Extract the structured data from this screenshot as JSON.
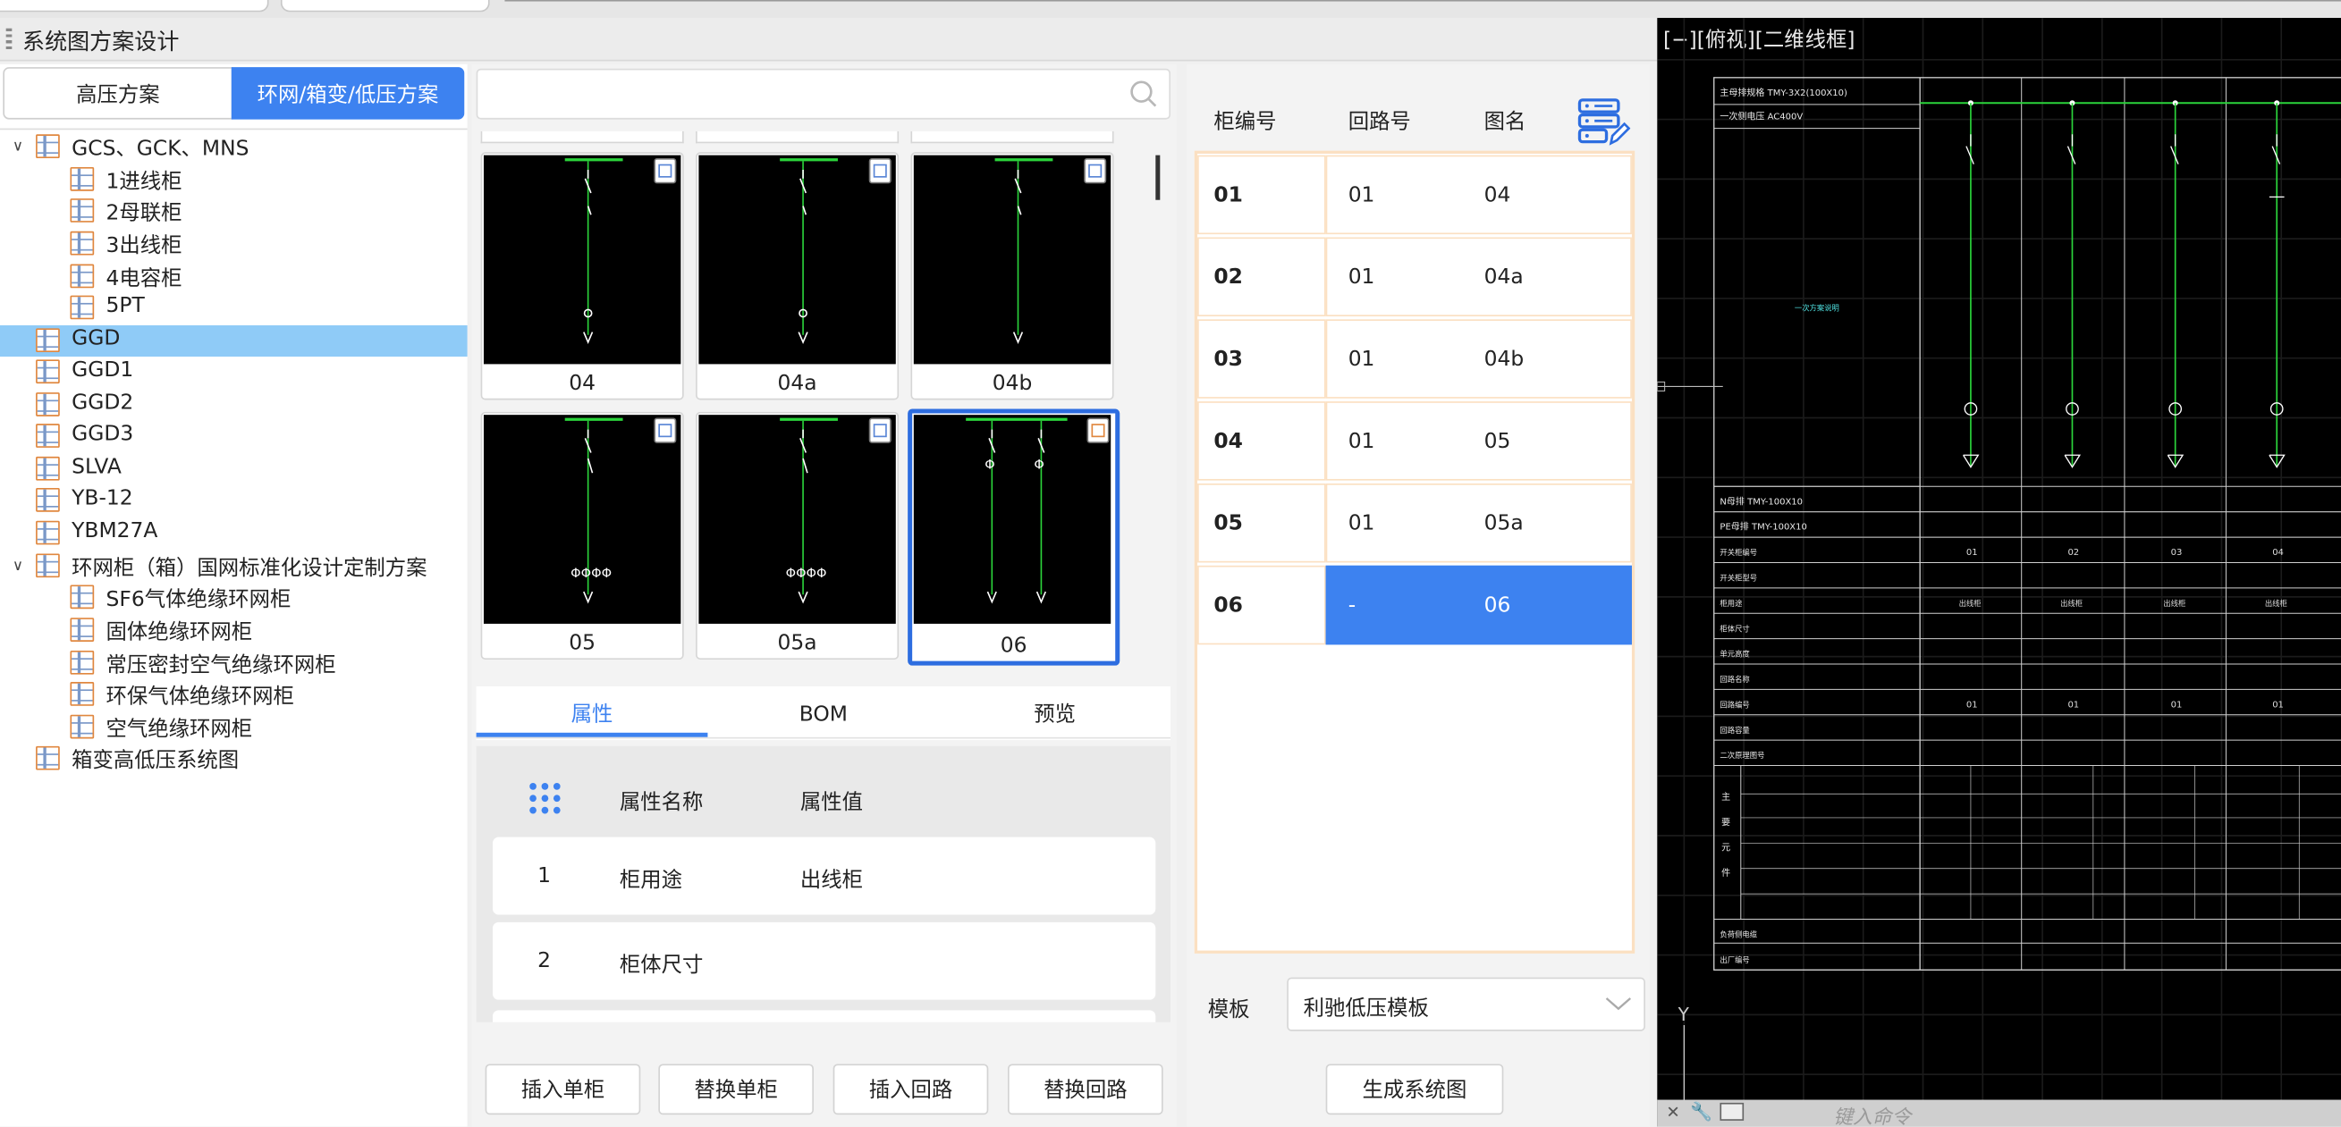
{
  "window": {
    "title": "系统图方案设计"
  },
  "left_tabs": {
    "high": "高压方案",
    "ring": "环网/箱变/低压方案"
  },
  "tree": [
    {
      "label": "GCS、GCK、MNS",
      "expanded": true
    },
    {
      "label": "1进线柜"
    },
    {
      "label": "2母联柜"
    },
    {
      "label": "3出线柜"
    },
    {
      "label": "4电容柜"
    },
    {
      "label": "5PT"
    },
    {
      "label": "GGD",
      "selected": true
    },
    {
      "label": "GGD1"
    },
    {
      "label": "GGD2"
    },
    {
      "label": "GGD3"
    },
    {
      "label": "SLVA"
    },
    {
      "label": "YB-12"
    },
    {
      "label": "YBM27A"
    },
    {
      "label": "环网柜（箱）国网标准化设计定制方案",
      "expanded": true
    },
    {
      "label": "SF6气体绝缘环网柜"
    },
    {
      "label": "固体绝缘环网柜"
    },
    {
      "label": "常压密封空气绝缘环网柜"
    },
    {
      "label": "环保气体绝缘环网柜"
    },
    {
      "label": "空气绝缘环网柜"
    },
    {
      "label": "箱变高低压系统图"
    }
  ],
  "search": {
    "placeholder": ""
  },
  "thumbnails": [
    {
      "label": "04"
    },
    {
      "label": "04a"
    },
    {
      "label": "04b"
    },
    {
      "label": "05"
    },
    {
      "label": "05a"
    },
    {
      "label": "06",
      "selected": true
    }
  ],
  "prop_tabs": {
    "attr": "属性",
    "bom": "BOM",
    "preview": "预览"
  },
  "prop_table": {
    "header": {
      "name": "属性名称",
      "value": "属性值"
    },
    "rows": [
      {
        "index": "1",
        "name": "柜用途",
        "value": "出线柜"
      },
      {
        "index": "2",
        "name": "柜体尺寸",
        "value": ""
      }
    ]
  },
  "buttons": {
    "insert_cabinet": "插入单柜",
    "replace_cabinet": "替换单柜",
    "insert_circuit": "插入回路",
    "replace_circuit": "替换回路",
    "generate": "生成系统图"
  },
  "grid": {
    "headers": {
      "cabinet": "柜编号",
      "circuit": "回路号",
      "drawing": "图名"
    },
    "rows": [
      {
        "cabinet": "01",
        "circuit": "01",
        "drawing": "04"
      },
      {
        "cabinet": "02",
        "circuit": "01",
        "drawing": "04a"
      },
      {
        "cabinet": "03",
        "circuit": "01",
        "drawing": "04b"
      },
      {
        "cabinet": "04",
        "circuit": "01",
        "drawing": "05"
      },
      {
        "cabinet": "05",
        "circuit": "01",
        "drawing": "05a"
      },
      {
        "cabinet": "06",
        "circuit": "-",
        "drawing": "06",
        "selected": true
      }
    ]
  },
  "template": {
    "label": "模板",
    "value": "利驰低压模板"
  },
  "cad": {
    "title": "[−][俯视][二维线框]",
    "main_bus": "主母排规格 TMY-3X2(100X10)",
    "secondary": "一次侧电压 AC400V",
    "scheme_note": "一次方案说明",
    "n_bus": "N母排 TMY-100X10",
    "pe_bus": "PE母排 TMY-100X10",
    "row_labels": [
      "开关柜编号",
      "开关柜型号",
      "柜用途",
      "柜体尺寸",
      "单元高度",
      "回路名称",
      "回路编号",
      "回路容量",
      "二次原理图号",
      "",
      "",
      "",
      "",
      "",
      "",
      "",
      "",
      "",
      "",
      "",
      "",
      "",
      "",
      "",
      "",
      "",
      "",
      "",
      "",
      ""
    ],
    "row_labels_bottom": [
      "负荷侧电缆",
      "出厂编号"
    ],
    "vert_label": [
      "主",
      "要",
      "元",
      "件"
    ],
    "cabinet_nos": [
      "01",
      "02",
      "03",
      "04"
    ],
    "usage": [
      "出线柜",
      "出线柜",
      "出线柜",
      "出线柜"
    ],
    "circuit_nos": [
      "01",
      "01",
      "01",
      "01"
    ],
    "cmd_placeholder": "键入命令",
    "axis_y": "Y"
  }
}
